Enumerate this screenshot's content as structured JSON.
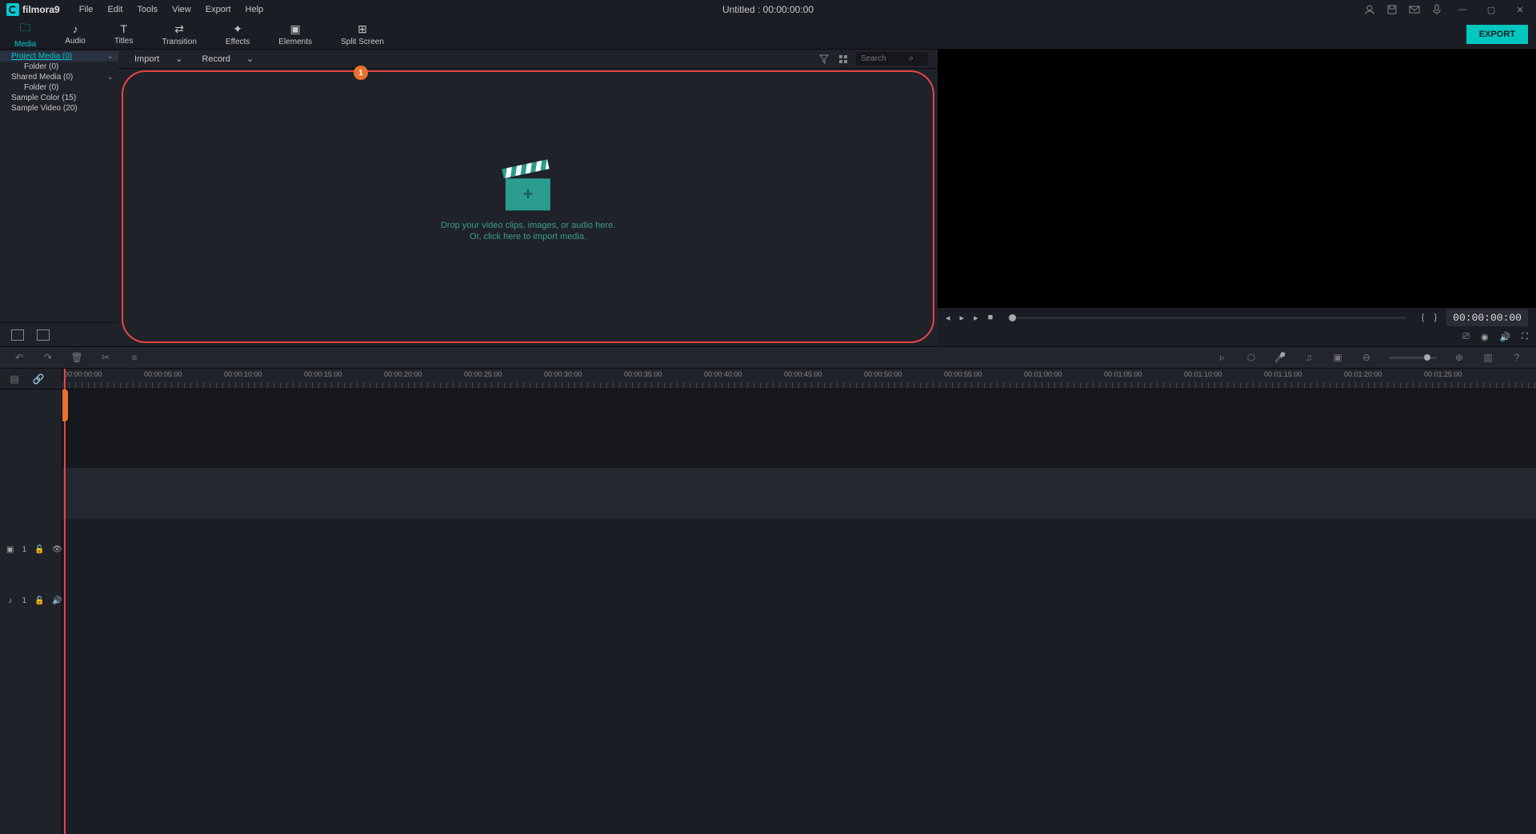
{
  "app": {
    "name": "filmora",
    "version": "9"
  },
  "menu": [
    "File",
    "Edit",
    "Tools",
    "View",
    "Export",
    "Help"
  ],
  "title": "Untitled : 00:00:00:00",
  "toolbar": {
    "tabs": [
      {
        "label": "Media",
        "icon": "folder"
      },
      {
        "label": "Audio",
        "icon": "note"
      },
      {
        "label": "Titles",
        "icon": "text"
      },
      {
        "label": "Transition",
        "icon": "swap"
      },
      {
        "label": "Effects",
        "icon": "sparkle"
      },
      {
        "label": "Elements",
        "icon": "element"
      },
      {
        "label": "Split Screen",
        "icon": "grid"
      }
    ],
    "export_label": "EXPORT"
  },
  "sidebar": {
    "items": [
      {
        "label": "Project Media (0)",
        "expandable": true,
        "selected": true
      },
      {
        "label": "Folder (0)",
        "child": true
      },
      {
        "label": "Shared Media (0)",
        "expandable": true
      },
      {
        "label": "Folder (0)",
        "child": true
      },
      {
        "label": "Sample Color (15)"
      },
      {
        "label": "Sample Video (20)"
      }
    ]
  },
  "media_toolbar": {
    "import_label": "Import",
    "record_label": "Record",
    "search_placeholder": "Search"
  },
  "media_drop": {
    "badge": "1",
    "line1": "Drop your video clips, images, or audio here.",
    "line2": "Or, click here to import media."
  },
  "preview": {
    "timecode": "00:00:00:00"
  },
  "timeline": {
    "ruler_marks": [
      "00:00:00:00",
      "00:00:05:00",
      "00:00:10:00",
      "00:00:15:00",
      "00:00:20:00",
      "00:00:25:00",
      "00:00:30:00",
      "00:00:35:00",
      "00:00:40:00",
      "00:00:45:00",
      "00:00:50:00",
      "00:00:55:00",
      "00:01:00:00",
      "00:01:05:00",
      "00:01:10:00",
      "00:01:15:00",
      "00:01:20:00",
      "00:01:25:00"
    ],
    "video_track_num": "1",
    "audio_track_num": "1"
  }
}
